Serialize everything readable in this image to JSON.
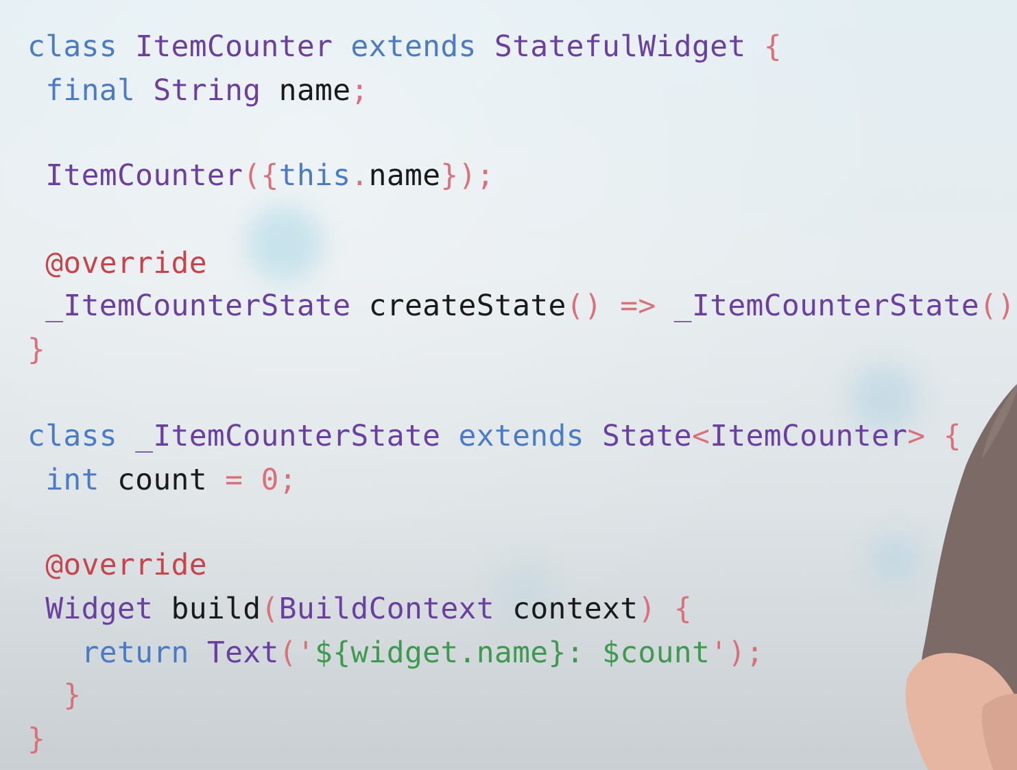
{
  "colors": {
    "keyword": "#4a7bc4",
    "type": "#6a3fa0",
    "identifier": "#1a1a1a",
    "punctuation": "#d9707a",
    "number": "#d9707a",
    "annotation": "#c8444d",
    "string": "#3f9a4f"
  },
  "lines": [
    {
      "name": "line-class-itemcounter",
      "tokens": [
        {
          "t": "class ",
          "c": "keyword"
        },
        {
          "t": "ItemCounter ",
          "c": "type"
        },
        {
          "t": "extends ",
          "c": "keyword"
        },
        {
          "t": "StatefulWidget ",
          "c": "type"
        },
        {
          "t": "{",
          "c": "punctuation"
        }
      ]
    },
    {
      "name": "line-final-name",
      "tokens": [
        {
          "t": " final ",
          "c": "keyword"
        },
        {
          "t": "String ",
          "c": "type"
        },
        {
          "t": "name",
          "c": "identifier"
        },
        {
          "t": ";",
          "c": "punctuation"
        }
      ]
    },
    {
      "name": "line-constructor",
      "tokens": [
        {
          "t": " ItemCounter",
          "c": "type"
        },
        {
          "t": "({",
          "c": "punctuation"
        },
        {
          "t": "this",
          "c": "keyword"
        },
        {
          "t": ".",
          "c": "punctuation"
        },
        {
          "t": "name",
          "c": "identifier"
        },
        {
          "t": "});",
          "c": "punctuation"
        }
      ]
    },
    {
      "name": "line-override-1",
      "tokens": [
        {
          "t": " @override",
          "c": "annotation"
        }
      ]
    },
    {
      "name": "line-createstate",
      "tokens": [
        {
          "t": " _ItemCounterState ",
          "c": "type"
        },
        {
          "t": "createState",
          "c": "identifier"
        },
        {
          "t": "() => ",
          "c": "punctuation"
        },
        {
          "t": "_ItemCounterState",
          "c": "type"
        },
        {
          "t": "();",
          "c": "punctuation"
        }
      ]
    },
    {
      "name": "line-close-class-1",
      "tokens": [
        {
          "t": "}",
          "c": "punctuation"
        }
      ]
    },
    {
      "name": "line-class-state",
      "tokens": [
        {
          "t": "class ",
          "c": "keyword"
        },
        {
          "t": "_ItemCounterState ",
          "c": "type"
        },
        {
          "t": "extends ",
          "c": "keyword"
        },
        {
          "t": "State",
          "c": "type"
        },
        {
          "t": "<",
          "c": "punctuation"
        },
        {
          "t": "ItemCounter",
          "c": "type"
        },
        {
          "t": "> {",
          "c": "punctuation"
        }
      ]
    },
    {
      "name": "line-int-count",
      "tokens": [
        {
          "t": " int ",
          "c": "keyword"
        },
        {
          "t": "count ",
          "c": "identifier"
        },
        {
          "t": "= ",
          "c": "punctuation"
        },
        {
          "t": "0",
          "c": "number"
        },
        {
          "t": ";",
          "c": "punctuation"
        }
      ]
    },
    {
      "name": "line-override-2",
      "tokens": [
        {
          "t": " @override",
          "c": "annotation"
        }
      ]
    },
    {
      "name": "line-build",
      "tokens": [
        {
          "t": " Widget ",
          "c": "type"
        },
        {
          "t": "build",
          "c": "identifier"
        },
        {
          "t": "(",
          "c": "punctuation"
        },
        {
          "t": "BuildContext ",
          "c": "type"
        },
        {
          "t": "context",
          "c": "identifier"
        },
        {
          "t": ") {",
          "c": "punctuation"
        }
      ]
    },
    {
      "name": "line-return",
      "tokens": [
        {
          "t": "   return ",
          "c": "keyword"
        },
        {
          "t": "Text",
          "c": "type"
        },
        {
          "t": "('",
          "c": "punctuation"
        },
        {
          "t": "${widget.name}: $count",
          "c": "string"
        },
        {
          "t": "');",
          "c": "punctuation"
        }
      ]
    },
    {
      "name": "line-close-build",
      "tokens": [
        {
          "t": "  }",
          "c": "punctuation"
        }
      ]
    },
    {
      "name": "line-close-class-2",
      "tokens": [
        {
          "t": "}",
          "c": "punctuation"
        }
      ]
    }
  ]
}
